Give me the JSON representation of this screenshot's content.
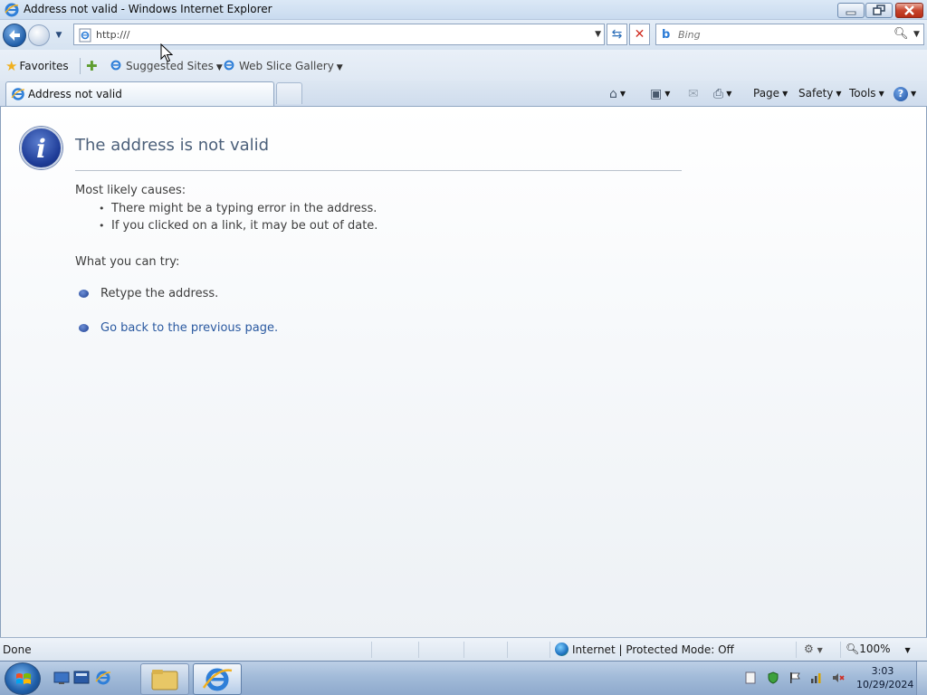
{
  "window": {
    "title": "Address not valid - Windows Internet Explorer"
  },
  "navbar": {
    "address_value": "http:///",
    "search_placeholder": "Bing"
  },
  "favorites_bar": {
    "favorites_label": "Favorites",
    "links": [
      "Suggested Sites",
      "Web Slice Gallery"
    ]
  },
  "tabs": [
    {
      "label": "Address not valid",
      "active": true
    }
  ],
  "command_bar": {
    "page_label": "Page",
    "safety_label": "Safety",
    "tools_label": "Tools",
    "help_glyph": "?"
  },
  "content": {
    "title": "The address is not valid",
    "causes_heading": "Most likely causes:",
    "causes": [
      "There might be a typing error in the address.",
      "If you clicked on a link, it may be out of date."
    ],
    "try_heading": "What you can try:",
    "try_items": [
      {
        "text": "Retype the address.",
        "link": false
      },
      {
        "text": "Go back to the previous page.",
        "link": true
      }
    ]
  },
  "statusbar": {
    "status": "Done",
    "zone": "Internet | Protected Mode: Off",
    "zoom": "100%"
  },
  "taskbar": {
    "time": "3:03",
    "date": "10/29/2024"
  },
  "icons": {
    "info": "info-icon",
    "back": "back-arrow-icon",
    "forward": "forward-arrow-icon",
    "refresh": "refresh-icon",
    "stop": "stop-icon",
    "search": "magnifier-icon"
  },
  "colors": {
    "title_text": "#4c607a",
    "link_text": "#2a59a0",
    "info_blue": "#1e3c97"
  }
}
